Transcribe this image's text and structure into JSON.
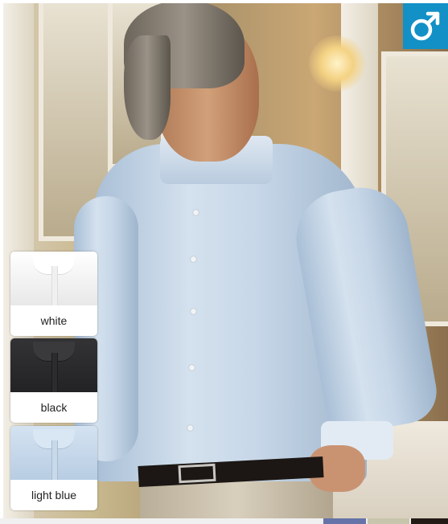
{
  "product": {
    "gender_icon": "male-symbol-icon",
    "badge_color": "#1390c6",
    "swatches": [
      {
        "label": "white",
        "color": "#f4f4f4"
      },
      {
        "label": "black",
        "color": "#2a2a2c"
      },
      {
        "label": "light blue",
        "color": "#c3d6ea"
      }
    ]
  },
  "bottom_strip": {
    "colors": [
      "#6673a8",
      "#c7c5ab",
      "#231a16"
    ]
  }
}
